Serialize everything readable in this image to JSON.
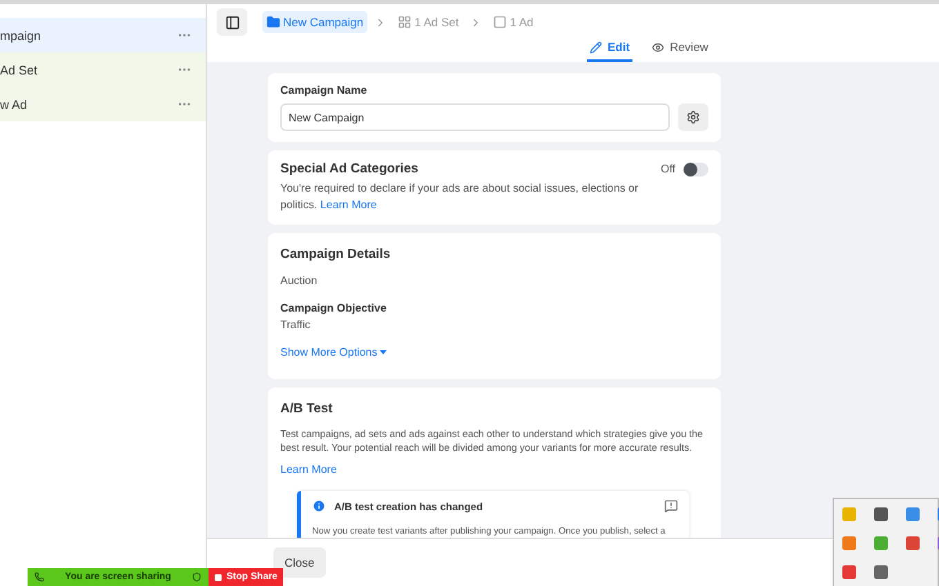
{
  "sidebar": {
    "items": [
      {
        "label": "mpaign",
        "selected": true
      },
      {
        "label": "Ad Set",
        "selected": false
      },
      {
        "label": "w Ad",
        "selected": false
      }
    ]
  },
  "breadcrumb": [
    {
      "kind": "campaign",
      "label": "New Campaign",
      "selected": true
    },
    {
      "kind": "adset",
      "label": "1 Ad Set",
      "selected": false
    },
    {
      "kind": "ad",
      "label": "1 Ad",
      "selected": false
    }
  ],
  "tabs": [
    {
      "kind": "edit",
      "label": "Edit",
      "selected": true
    },
    {
      "kind": "review",
      "label": "Review",
      "selected": false
    }
  ],
  "campaign_name": {
    "label": "Campaign Name",
    "value": "New Campaign"
  },
  "special_ad_categories": {
    "title": "Special Ad Categories",
    "text": "You're required to declare if your ads are about social issues, elections or politics.",
    "link": "Learn More",
    "toggle_label": "Off",
    "on": false
  },
  "campaign_details": {
    "title": "Campaign Details",
    "buying_type": "Auction",
    "objective_label": "Campaign Objective",
    "objective": "Traffic",
    "more": "Show More Options"
  },
  "ab_test": {
    "title": "A/B Test",
    "text": "Test campaigns, ad sets and ads against each other to understand which strategies give you the best result. Your potential reach will be divided among your variants for more accurate results.",
    "link": "Learn More",
    "notice_title": "A/B test creation has changed",
    "notice_text": "Now you create test variants after publishing your campaign. Once you publish, select a"
  },
  "footer": {
    "button": "Close"
  },
  "screen_share": {
    "status": "You are screen sharing",
    "stop": "Stop Share"
  }
}
